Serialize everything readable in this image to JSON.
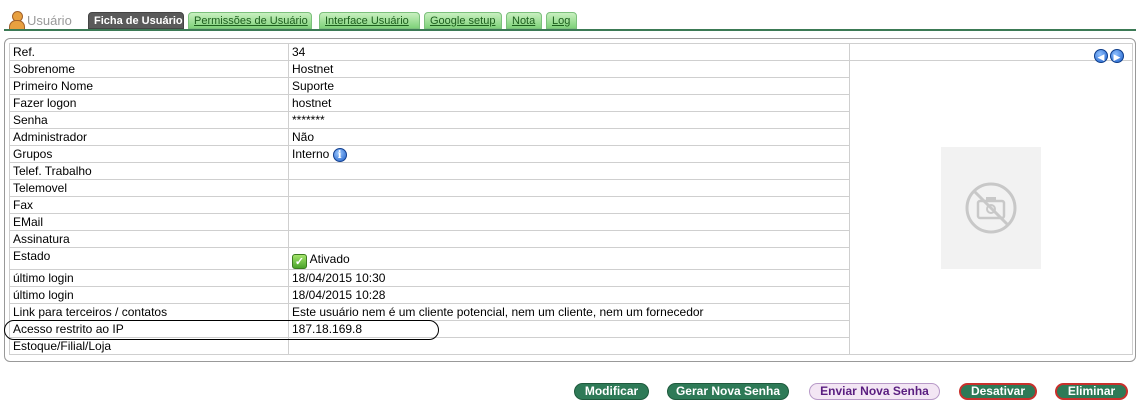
{
  "header": {
    "section_label": "Usuário",
    "tabs": [
      {
        "label": "Ficha de Usuário",
        "active": true
      },
      {
        "label": "Permissões de Usuário"
      },
      {
        "label": "Interface Usuário"
      },
      {
        "label": "Google setup"
      },
      {
        "label": "Nota"
      },
      {
        "label": "Log"
      }
    ]
  },
  "record": {
    "rows": [
      {
        "label": "Ref.",
        "value": "34"
      },
      {
        "label": "Sobrenome",
        "value": "Hostnet"
      },
      {
        "label": "Primeiro Nome",
        "value": "Suporte"
      },
      {
        "label": "Fazer logon",
        "value": "hostnet"
      },
      {
        "label": "Senha",
        "value": "*******"
      },
      {
        "label": "Administrador",
        "value": "Não"
      },
      {
        "label": "Grupos",
        "value": "Interno"
      },
      {
        "label": "Telef. Trabalho",
        "value": ""
      },
      {
        "label": "Telemovel",
        "value": ""
      },
      {
        "label": "Fax",
        "value": ""
      },
      {
        "label": "EMail",
        "value": ""
      },
      {
        "label": "Assinatura",
        "value": ""
      },
      {
        "label": "Estado",
        "value": "Ativado"
      },
      {
        "label": "último login",
        "value": "18/04/2015 10:30"
      },
      {
        "label": "último login",
        "value": "18/04/2015 10:28"
      },
      {
        "label": "Link para terceiros / contatos",
        "value": "Este usuário nem é um cliente potencial, nem um cliente, nem um fornecedor"
      },
      {
        "label": "Acesso restrito ao IP",
        "value": "187.18.169.8"
      },
      {
        "label": "Estoque/Filial/Loja",
        "value": ""
      }
    ]
  },
  "actions": {
    "modify": "Modificar",
    "new_password": "Gerar Nova Senha",
    "send_password": "Enviar Nova Senha",
    "deactivate": "Desativar",
    "delete": "Eliminar"
  },
  "colors": {
    "tab_green": "#7fd27a",
    "tab_active": "#5a5a5a",
    "button_green": "#2e7a57",
    "button_red_border": "#c9302c"
  }
}
